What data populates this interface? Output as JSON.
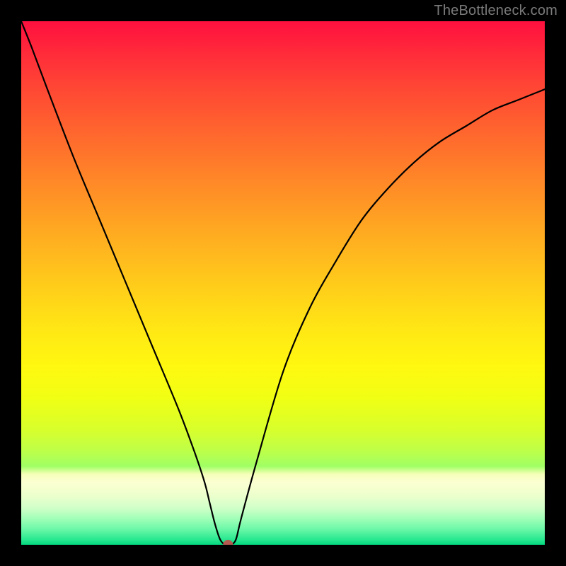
{
  "watermark": "TheBottleneck.com",
  "chart_data": {
    "type": "line",
    "title": "",
    "xlabel": "",
    "ylabel": "",
    "xlim": [
      0,
      100
    ],
    "ylim": [
      0,
      100
    ],
    "background": "rainbow-gradient-red-to-green",
    "series": [
      {
        "name": "bottleneck-curve",
        "x": [
          0,
          2,
          5,
          10,
          15,
          20,
          25,
          30,
          33,
          35,
          36,
          37,
          38,
          39,
          40,
          41,
          42,
          45,
          50,
          55,
          60,
          65,
          70,
          75,
          80,
          85,
          90,
          95,
          100
        ],
        "values": [
          100,
          95,
          87,
          74,
          62,
          50,
          38,
          26,
          18,
          12,
          8,
          4,
          1,
          0,
          0,
          1,
          5,
          16,
          33,
          45,
          54,
          62,
          68,
          73,
          77,
          80,
          83,
          85,
          87
        ]
      }
    ],
    "marker": {
      "x": 39.5,
      "y": 0,
      "color": "#b55a50"
    },
    "grid": false,
    "legend": false
  }
}
